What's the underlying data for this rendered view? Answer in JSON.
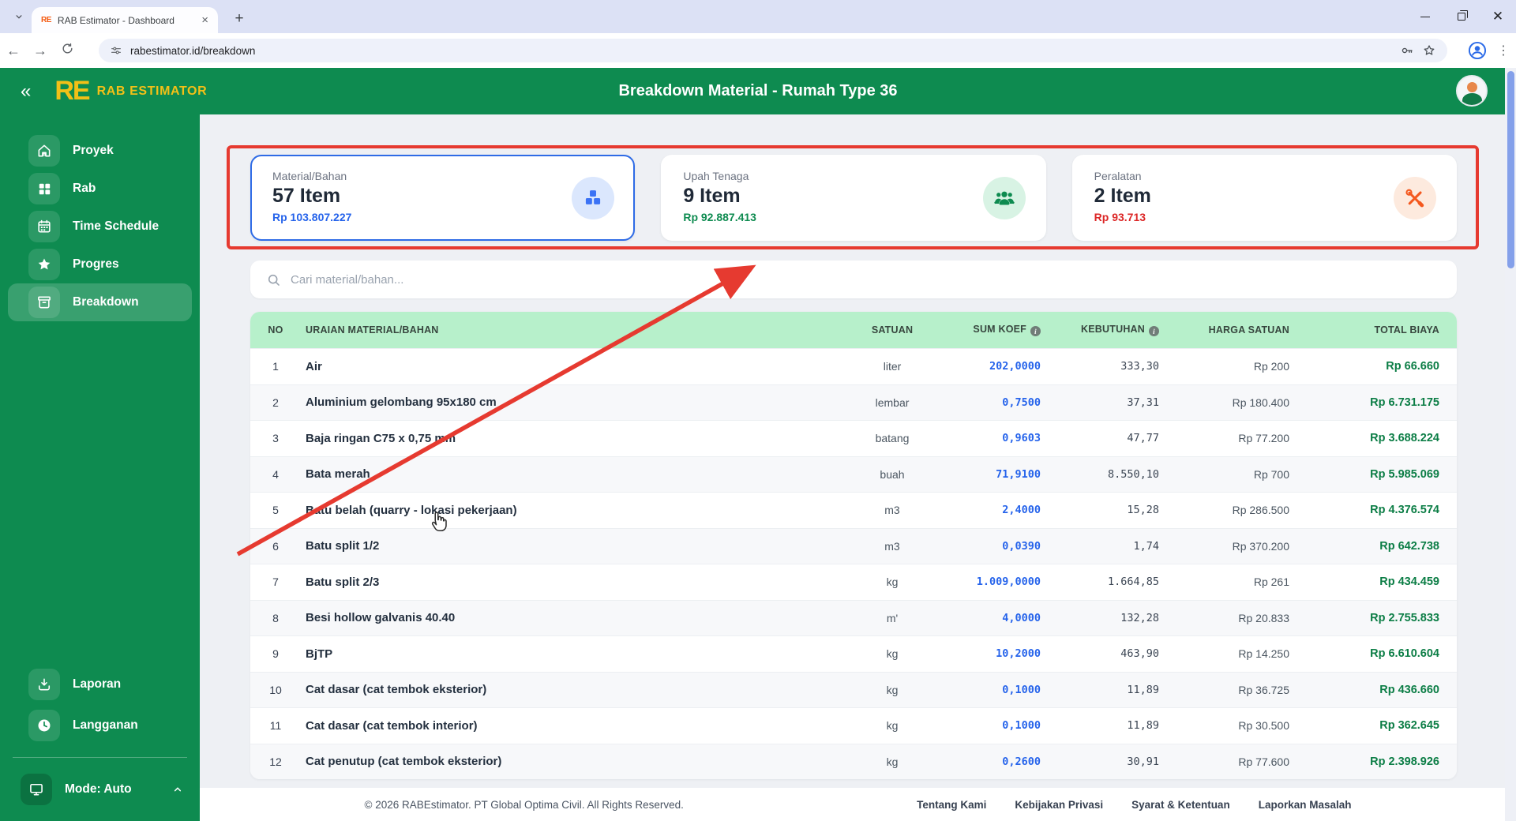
{
  "browser": {
    "tab_title": "RAB Estimator - Dashboard",
    "favicon_text": "RE",
    "url": "rabestimator.id/breakdown"
  },
  "header": {
    "collapse_glyph": "«",
    "logo_monogram": "RE",
    "logo_text": "RAB ESTIMATOR",
    "title": "Breakdown Material - Rumah Type 36"
  },
  "sidebar": {
    "items": [
      {
        "label": "Proyek",
        "icon": "home",
        "active": false
      },
      {
        "label": "Rab",
        "icon": "grid",
        "active": false
      },
      {
        "label": "Time Schedule",
        "icon": "calendar",
        "active": false
      },
      {
        "label": "Progres",
        "icon": "star",
        "active": false
      },
      {
        "label": "Breakdown",
        "icon": "archive",
        "active": true
      }
    ],
    "bottom_items": [
      {
        "label": "Laporan",
        "icon": "download"
      },
      {
        "label": "Langganan",
        "icon": "clock"
      }
    ],
    "mode_label": "Mode: Auto"
  },
  "cards": [
    {
      "label": "Material/Bahan",
      "count": "57 Item",
      "amount": "Rp 103.807.227",
      "amount_color": "#2563eb",
      "icon": "cubes",
      "icon_color": "#3b72f5",
      "icon_bg": "#dbe7fd",
      "selected": true
    },
    {
      "label": "Upah Tenaga",
      "count": "9 Item",
      "amount": "Rp 92.887.413",
      "amount_color": "#0e8b50",
      "icon": "people",
      "icon_color": "#0e8b50",
      "icon_bg": "#d8f3e4",
      "selected": false
    },
    {
      "label": "Peralatan",
      "count": "2 Item",
      "amount": "Rp 93.713",
      "amount_color": "#dc2626",
      "icon": "tools",
      "icon_color": "#f4581e",
      "icon_bg": "#fdeade",
      "selected": false
    }
  ],
  "search": {
    "placeholder": "Cari material/bahan..."
  },
  "table": {
    "headers": [
      "NO",
      "URAIAN MATERIAL/BAHAN",
      "SATUAN",
      "SUM KOEF",
      "KEBUTUHAN",
      "HARGA SATUAN",
      "TOTAL BIAYA"
    ],
    "rows": [
      {
        "no": "1",
        "name": "Air",
        "satuan": "liter",
        "koef": "202,0000",
        "kebutuhan": "333,30",
        "harga": "Rp 200",
        "total": "Rp 66.660"
      },
      {
        "no": "2",
        "name": "Aluminium gelombang 95x180 cm",
        "satuan": "lembar",
        "koef": "0,7500",
        "kebutuhan": "37,31",
        "harga": "Rp 180.400",
        "total": "Rp 6.731.175"
      },
      {
        "no": "3",
        "name": "Baja ringan C75 x 0,75 mm",
        "satuan": "batang",
        "koef": "0,9603",
        "kebutuhan": "47,77",
        "harga": "Rp 77.200",
        "total": "Rp 3.688.224"
      },
      {
        "no": "4",
        "name": "Bata merah",
        "satuan": "buah",
        "koef": "71,9100",
        "kebutuhan": "8.550,10",
        "harga": "Rp 700",
        "total": "Rp 5.985.069"
      },
      {
        "no": "5",
        "name": "Batu belah (quarry - lokasi pekerjaan)",
        "satuan": "m3",
        "koef": "2,4000",
        "kebutuhan": "15,28",
        "harga": "Rp 286.500",
        "total": "Rp 4.376.574"
      },
      {
        "no": "6",
        "name": "Batu split 1/2",
        "satuan": "m3",
        "koef": "0,0390",
        "kebutuhan": "1,74",
        "harga": "Rp 370.200",
        "total": "Rp 642.738"
      },
      {
        "no": "7",
        "name": "Batu split 2/3",
        "satuan": "kg",
        "koef": "1.009,0000",
        "kebutuhan": "1.664,85",
        "harga": "Rp 261",
        "total": "Rp 434.459"
      },
      {
        "no": "8",
        "name": "Besi hollow galvanis 40.40",
        "satuan": "m'",
        "koef": "4,0000",
        "kebutuhan": "132,28",
        "harga": "Rp 20.833",
        "total": "Rp 2.755.833"
      },
      {
        "no": "9",
        "name": "BjTP",
        "satuan": "kg",
        "koef": "10,2000",
        "kebutuhan": "463,90",
        "harga": "Rp 14.250",
        "total": "Rp 6.610.604"
      },
      {
        "no": "10",
        "name": "Cat dasar (cat tembok eksterior)",
        "satuan": "kg",
        "koef": "0,1000",
        "kebutuhan": "11,89",
        "harga": "Rp 36.725",
        "total": "Rp 436.660"
      },
      {
        "no": "11",
        "name": "Cat dasar (cat tembok interior)",
        "satuan": "kg",
        "koef": "0,1000",
        "kebutuhan": "11,89",
        "harga": "Rp 30.500",
        "total": "Rp 362.645"
      },
      {
        "no": "12",
        "name": "Cat penutup (cat tembok eksterior)",
        "satuan": "kg",
        "koef": "0,2600",
        "kebutuhan": "30,91",
        "harga": "Rp 77.600",
        "total": "Rp 2.398.926"
      }
    ]
  },
  "footer": {
    "copyright": "© 2026 RABEstimator. PT Global Optima Civil. All Rights Reserved.",
    "links": [
      "Tentang Kami",
      "Kebijakan Privasi",
      "Syarat & Ketentuan",
      "Laporkan Masalah"
    ]
  },
  "colors": {
    "brand_green": "#0e8b50",
    "brand_yellow": "#f2c017",
    "accent_blue": "#2563eb",
    "accent_red": "#dc2626",
    "table_header_green": "#b7f0cb",
    "annotation_red": "#e63a30"
  }
}
